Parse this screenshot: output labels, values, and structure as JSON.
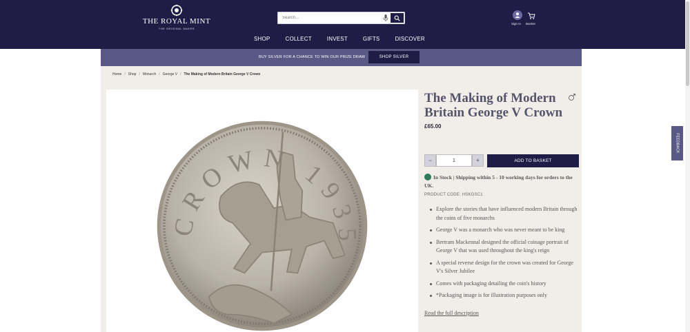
{
  "header": {
    "logo_text": "THE ROYAL MINT",
    "logo_subtext": "THE ORIGINAL MAKER",
    "search_placeholder": "Search...",
    "signin_label": "Sign In",
    "basket_label": "Basket",
    "nav": [
      "SHOP",
      "COLLECT",
      "INVEST",
      "GIFTS",
      "DISCOVER"
    ]
  },
  "promo": {
    "text": "BUY SILVER FOR A CHANCE TO WIN OUR PRIZE DRAW",
    "button": "SHOP SILVER"
  },
  "breadcrumb": [
    "Home",
    "Shop",
    "Monarch",
    "George V",
    "The Making of Modern Britain George V Crown"
  ],
  "product": {
    "title": "The Making of Modern Britain George V Crown",
    "price": "£65.00",
    "quantity": "1",
    "qty_minus": "−",
    "qty_plus": "+",
    "add_to_basket": "ADD TO BASKET",
    "stock_bold": "In Stock | Shipping within 5 - 10 working days for orders to the UK.",
    "code": "PRODUCT CODE: HSKGSC1",
    "bullets": [
      "Explore the stories that have influenced modern Britain through the coins of five monarchs",
      "George V was a monarch who was never meant to be king",
      "Bertram Mackennal designed the official coinage portrait of George V that was used throughout the king's reign",
      "A special reverse design for the crown was created for George V's Silver Jubilee",
      "Comes with packaging detailing the coin's history",
      "*Packaging image is for illustration purposes only"
    ],
    "read_more": "Read the full description",
    "coin_legend": "CROWN 1935"
  },
  "feedback_label": "FEEDBACK",
  "colors": {
    "header_bg": "#1f1d45",
    "promo_bg": "#5a5885",
    "page_bg": "#f1eee9",
    "in_stock_green": "#2e7a5a"
  }
}
